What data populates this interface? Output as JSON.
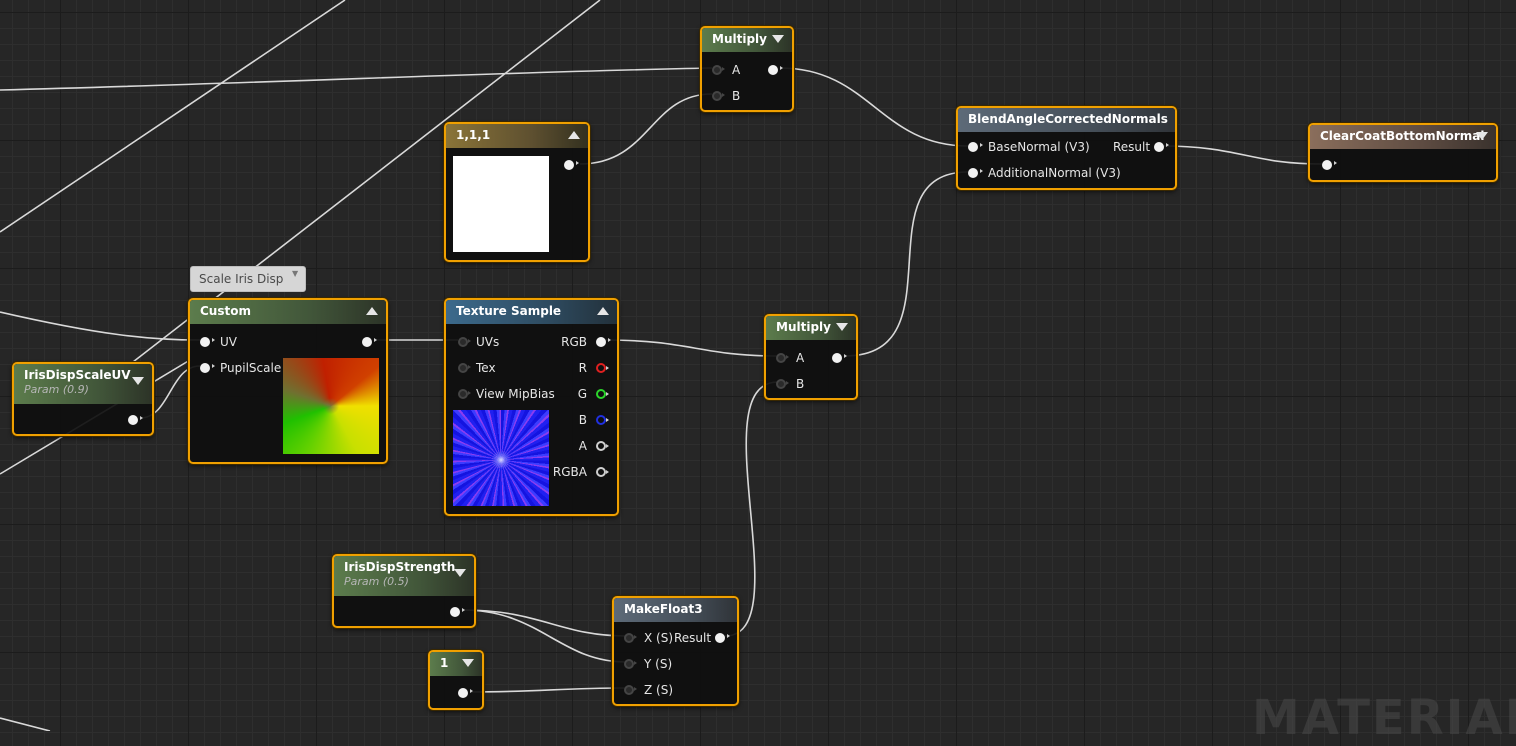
{
  "nodes": {
    "multiply_top": {
      "title": "Multiply",
      "inputs": [
        "A",
        "B"
      ]
    },
    "const_111": {
      "title": "1,1,1"
    },
    "blend": {
      "title": "BlendAngleCorrectedNormals",
      "inputs": [
        "BaseNormal (V3)",
        "AdditionalNormal (V3)"
      ],
      "output": "Result"
    },
    "clearcoat": {
      "title": "ClearCoatBottomNormal"
    },
    "custom": {
      "title": "Custom",
      "inputs": [
        "UV",
        "PupilScale"
      ],
      "comment": "Scale Iris Disp"
    },
    "texture": {
      "title": "Texture Sample",
      "inputs": [
        "UVs",
        "Tex",
        "View MipBias"
      ],
      "outputs": [
        "RGB",
        "R",
        "G",
        "B",
        "A",
        "RGBA"
      ]
    },
    "multiply_mid": {
      "title": "Multiply",
      "inputs": [
        "A",
        "B"
      ]
    },
    "scale_uv": {
      "title": "IrisDispScaleUV",
      "subtitle": "Param (0.9)"
    },
    "strength": {
      "title": "IrisDispStrength",
      "subtitle": "Param (0.5)"
    },
    "const_1": {
      "title": "1"
    },
    "makefloat3": {
      "title": "MakeFloat3",
      "inputs": [
        "X (S)",
        "Y (S)",
        "Z (S)"
      ],
      "output": "Result"
    }
  },
  "watermark": "MATERIAL",
  "colors": {
    "selection_border": "#f0a000",
    "wire": "#d9d9d9",
    "graph_bg": "#262626"
  }
}
